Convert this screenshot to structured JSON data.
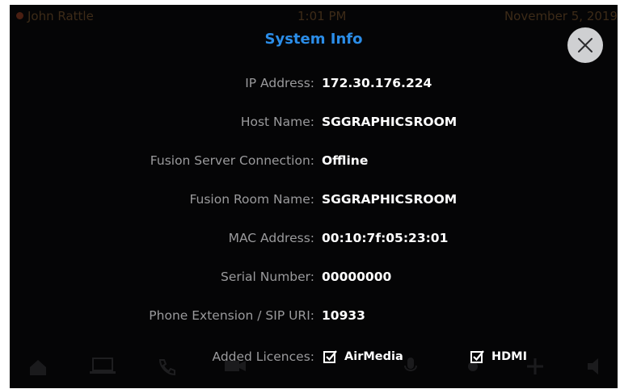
{
  "status_bar": {
    "user": "John Rattle",
    "time": "1:01 PM",
    "date": "November 5, 2019"
  },
  "dock_icons": [
    "home-icon",
    "laptop-icon",
    "phone-icon",
    "camera-icon",
    "microphone-icon",
    "lights-icon",
    "brightness-icon",
    "volume-icon"
  ],
  "modal": {
    "title": "System Info",
    "close_icon": "close-icon",
    "rows": [
      {
        "label": "IP Address:",
        "value": "172.30.176.224"
      },
      {
        "label": "Host Name:",
        "value": "SGGRAPHICSROOM"
      },
      {
        "label": "Fusion Server Connection:",
        "value": "Offline"
      },
      {
        "label": "Fusion Room Name:",
        "value": "SGGRAPHICSROOM"
      },
      {
        "label": "MAC Address:",
        "value": "00:10:7f:05:23:01"
      },
      {
        "label": "Serial Number:",
        "value": "00000000"
      },
      {
        "label": "Phone Extension / SIP URI:",
        "value": "10933"
      }
    ],
    "licences": {
      "label": "Added Licences:",
      "items": [
        {
          "name": "AirMedia",
          "checked": true
        },
        {
          "name": "HDMI",
          "checked": true
        }
      ]
    }
  },
  "colors": {
    "title": "#2b8de8",
    "label": "#9a9a9c",
    "value": "#ffffff",
    "background": "#050506",
    "close_button": "#cfd0d2"
  }
}
